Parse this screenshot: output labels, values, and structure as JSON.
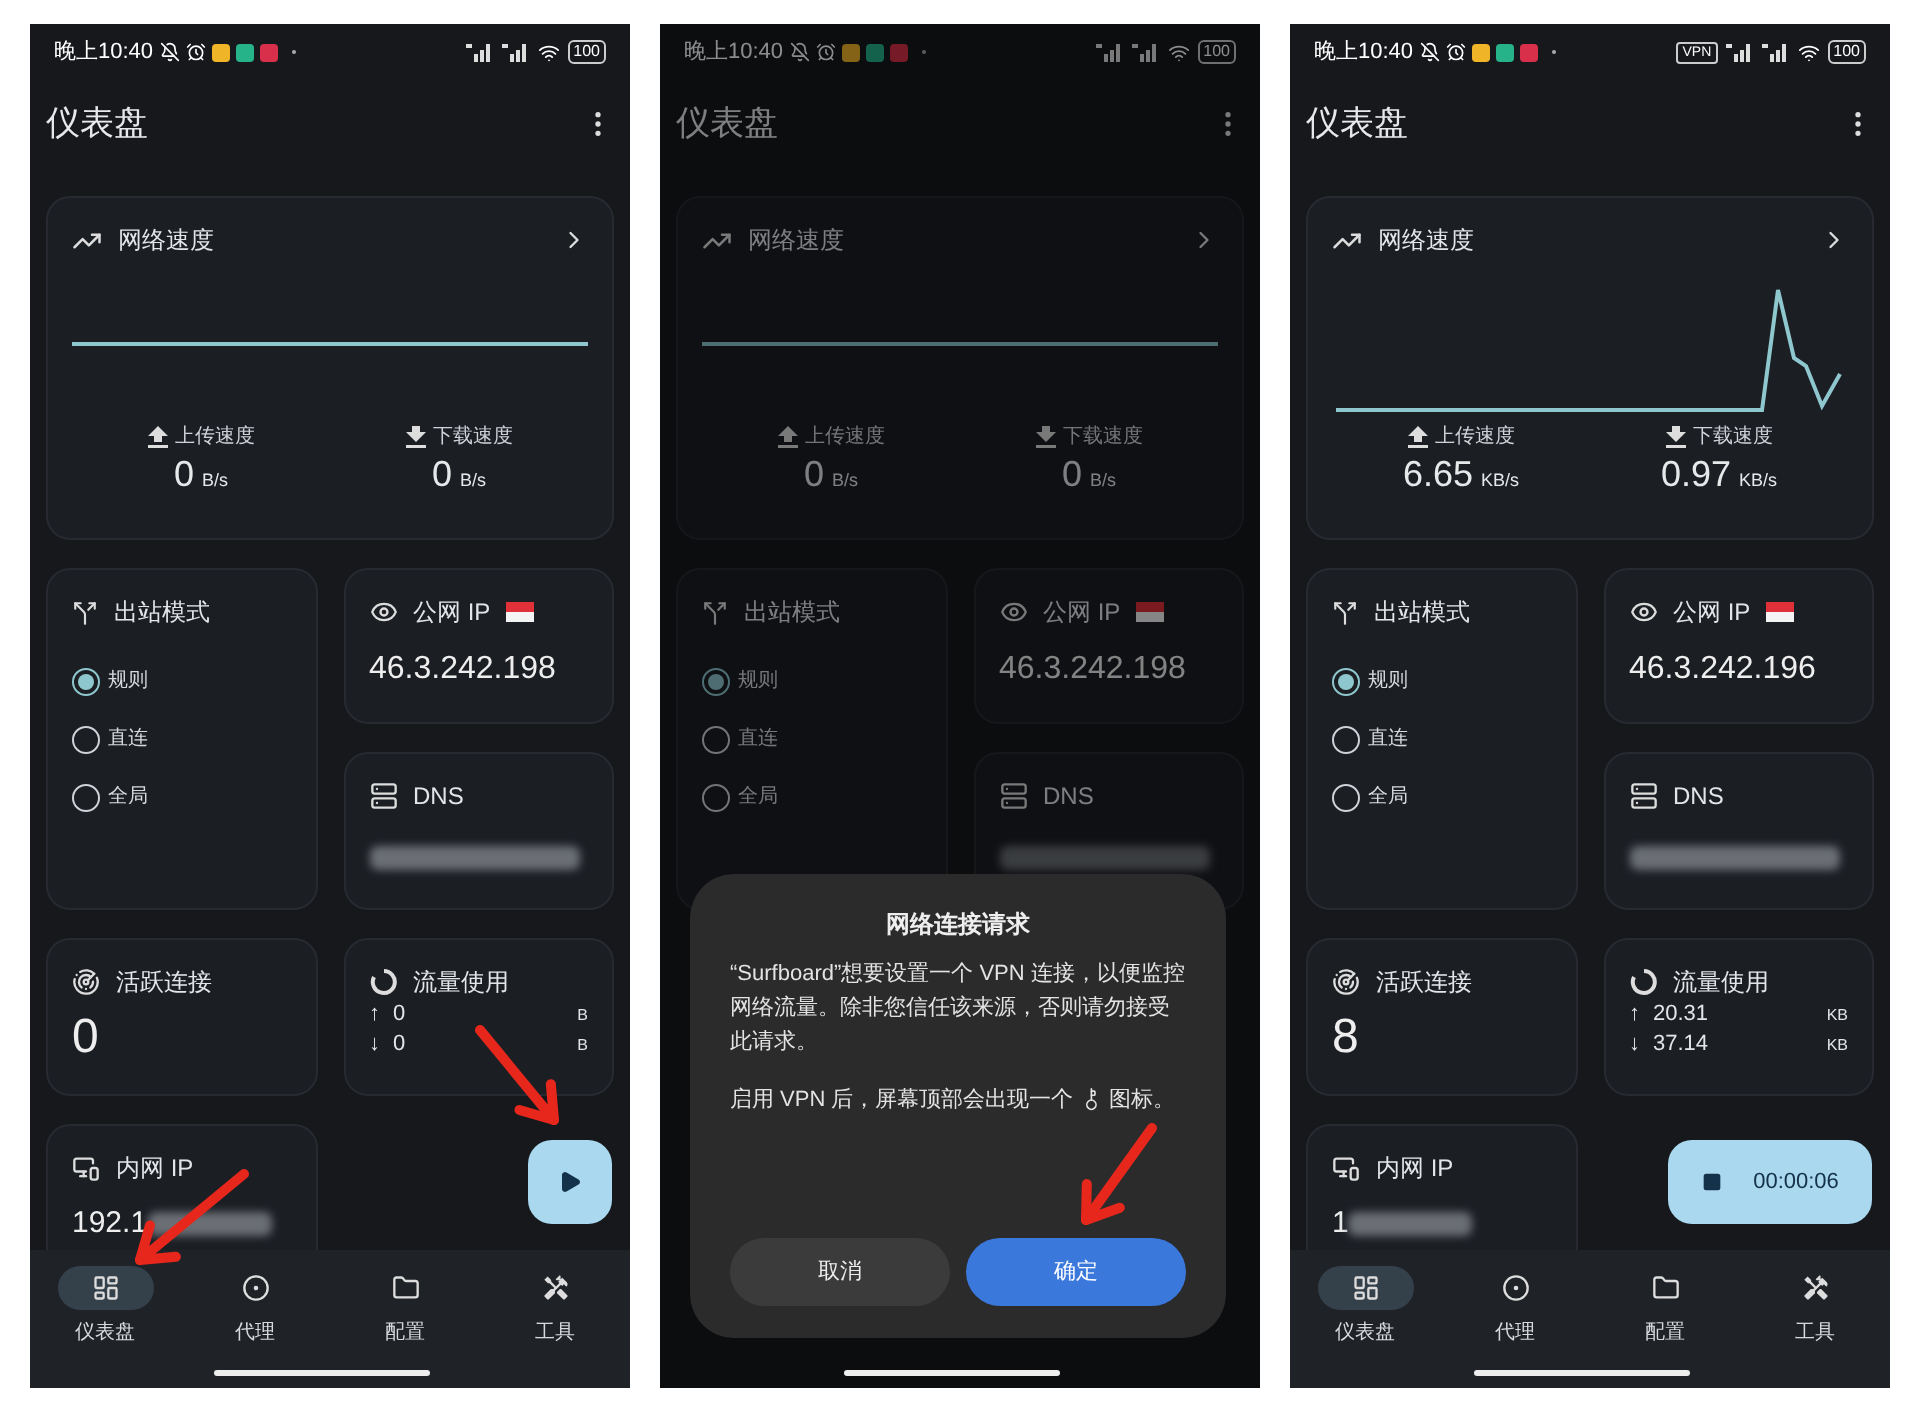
{
  "screens": [
    {
      "status_bar": {
        "time": "晚上10:40",
        "battery": "100"
      },
      "title": "仪表盘",
      "speed": {
        "title": "网络速度",
        "graph": {
          "kind": "flat"
        },
        "upload": {
          "label": "上传速度",
          "value": "0",
          "unit": "B/s"
        },
        "download": {
          "label": "下载速度",
          "value": "0",
          "unit": "B/s"
        }
      },
      "mode": {
        "title": "出站模式",
        "options": [
          {
            "label": "规则",
            "selected": true
          },
          {
            "label": "直连",
            "selected": false
          },
          {
            "label": "全局",
            "selected": false
          }
        ]
      },
      "public_ip": {
        "label": "公网 IP",
        "value": "46.3.242.198"
      },
      "dns": {
        "label": "DNS"
      },
      "active_connections": {
        "label": "活跃连接",
        "value": "0"
      },
      "traffic": {
        "label": "流量使用",
        "rows": [
          {
            "arrow": "↑",
            "value": "0",
            "unit": "B"
          },
          {
            "arrow": "↓",
            "value": "0",
            "unit": "B"
          }
        ]
      },
      "lan_ip": {
        "label": "内网 IP",
        "value": "192.1"
      },
      "start_button": {
        "kind": "play"
      },
      "nav": [
        {
          "label": "仪表盘",
          "selected": true
        },
        {
          "label": "代理",
          "selected": false
        },
        {
          "label": "配置",
          "selected": false
        },
        {
          "label": "工具",
          "selected": false
        }
      ],
      "arrows": [
        {
          "kind": "fab"
        },
        {
          "kind": "nav"
        }
      ]
    },
    {
      "status_bar": {
        "time": "晚上10:40",
        "battery": "100"
      },
      "title": "仪表盘",
      "speed": {
        "title": "网络速度",
        "graph": {
          "kind": "flat"
        },
        "upload": {
          "label": "上传速度",
          "value": "0",
          "unit": "B/s"
        },
        "download": {
          "label": "下载速度",
          "value": "0",
          "unit": "B/s"
        }
      },
      "mode": {
        "title": "出站模式",
        "options": [
          {
            "label": "规则",
            "selected": true
          },
          {
            "label": "直连",
            "selected": false
          },
          {
            "label": "全局",
            "selected": false
          }
        ]
      },
      "public_ip": {
        "label": "公网 IP",
        "value": "46.3.242.198"
      },
      "dns": {
        "label": "DNS"
      },
      "dialog": {
        "title": "网络连接请求",
        "body": "“Surfboard”想要设置一个 VPN 连接，以便监控网络流量。除非您信任该来源，否则请勿接受此请求。",
        "note_before": "启用 VPN 后，屏幕顶部会出现一个",
        "note_after": "图标。",
        "cancel": "取消",
        "confirm": "确定"
      },
      "arrows": [
        {
          "kind": "confirm"
        }
      ]
    },
    {
      "status_bar": {
        "time": "晚上10:40",
        "vpn": "VPN",
        "battery": "100"
      },
      "title": "仪表盘",
      "speed": {
        "title": "网络速度",
        "graph": {
          "kind": "spike"
        },
        "upload": {
          "label": "上传速度",
          "value": "6.65",
          "unit": "KB/s"
        },
        "download": {
          "label": "下载速度",
          "value": "0.97",
          "unit": "KB/s"
        }
      },
      "mode": {
        "title": "出站模式",
        "options": [
          {
            "label": "规则",
            "selected": true
          },
          {
            "label": "直连",
            "selected": false
          },
          {
            "label": "全局",
            "selected": false
          }
        ]
      },
      "public_ip": {
        "label": "公网 IP",
        "value": "46.3.242.196"
      },
      "dns": {
        "label": "DNS"
      },
      "active_connections": {
        "label": "活跃连接",
        "value": "8"
      },
      "traffic": {
        "label": "流量使用",
        "rows": [
          {
            "arrow": "↑",
            "value": "20.31",
            "unit": "KB"
          },
          {
            "arrow": "↓",
            "value": "37.14",
            "unit": "KB"
          }
        ]
      },
      "lan_ip": {
        "label": "内网 IP",
        "value": "1"
      },
      "start_button": {
        "kind": "stop",
        "timer": "00:00:06"
      },
      "nav": [
        {
          "label": "仪表盘",
          "selected": true
        },
        {
          "label": "代理",
          "selected": false
        },
        {
          "label": "配置",
          "selected": false
        },
        {
          "label": "工具",
          "selected": false
        }
      ]
    }
  ]
}
